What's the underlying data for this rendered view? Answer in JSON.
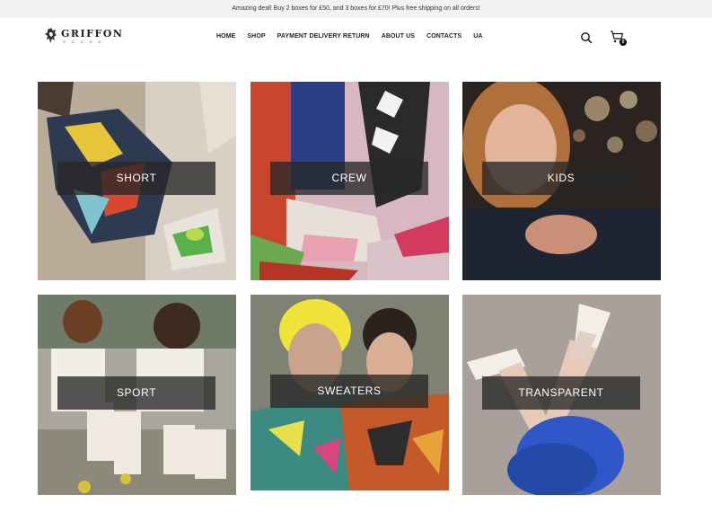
{
  "promo": {
    "text": "Amazing deal! Buy 2 boxes for £50, and 3 boxes for £70! Plus free shipping on all orders!"
  },
  "brand": {
    "name": "GRIFFON",
    "tagline": "SOCKS"
  },
  "nav": {
    "items": [
      {
        "label": "HOME"
      },
      {
        "label": "SHOP"
      },
      {
        "label": "PAYMENT DELIVERY RETURN"
      },
      {
        "label": "ABOUT US"
      },
      {
        "label": "CONTACTS"
      },
      {
        "label": "UA"
      }
    ]
  },
  "cart": {
    "count": "0"
  },
  "categories": [
    {
      "label": "SHORT"
    },
    {
      "label": "CREW"
    },
    {
      "label": "KIDS"
    },
    {
      "label": "SPORT"
    },
    {
      "label": "SWEATERS"
    },
    {
      "label": "TRANSPARENT"
    }
  ],
  "colors": {
    "promo_background": "#f2f2f2",
    "label_overlay": "#282828",
    "text_dark": "#222222"
  }
}
